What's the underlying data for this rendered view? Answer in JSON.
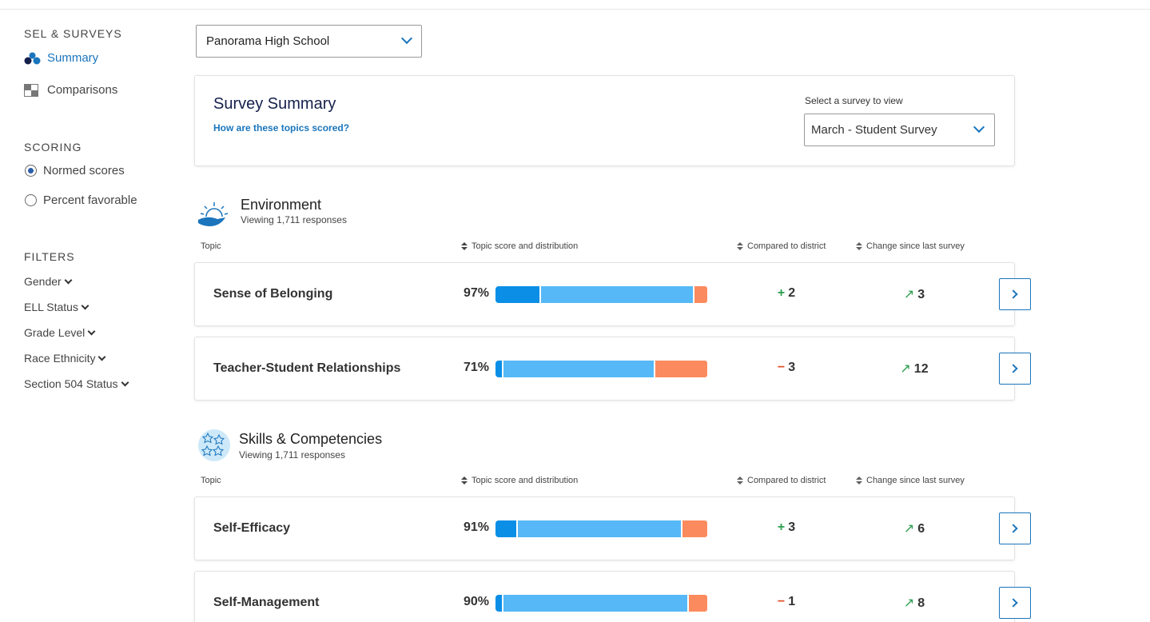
{
  "sidebar": {
    "sel_heading": "SEL & SURVEYS",
    "nav": [
      {
        "label": "Summary",
        "icon": "bubbles-icon",
        "active": true
      },
      {
        "label": "Comparisons",
        "icon": "grid-icon",
        "active": false
      }
    ],
    "scoring_heading": "SCORING",
    "scoring_options": [
      {
        "label": "Normed scores",
        "selected": true
      },
      {
        "label": "Percent favorable",
        "selected": false
      }
    ],
    "filters_heading": "FILTERS",
    "filters": [
      "Gender",
      "ELL Status",
      "Grade Level",
      "Race Ethnicity",
      "Section 504 Status"
    ]
  },
  "school_select": {
    "value": "Panorama High School"
  },
  "summary_card": {
    "title": "Survey Summary",
    "link": "How are these topics scored?",
    "survey_label": "Select a survey to view",
    "survey_value": "March - Student Survey"
  },
  "columns": {
    "topic": "Topic",
    "score": "Topic score and distribution",
    "compare": "Compared to district",
    "change": "Change since last survey"
  },
  "sections": [
    {
      "title": "Environment",
      "subtitle": "Viewing 1,711 responses",
      "icon": "sunrise-hand-icon",
      "rows": [
        {
          "name": "Sense of Belonging",
          "pct": "97%",
          "dist": [
            21,
            73,
            6
          ],
          "compare_sign": "+",
          "compare_val": "2",
          "change_val": "3"
        },
        {
          "name": "Teacher-Student Relationships",
          "pct": "71%",
          "dist": [
            3,
            72,
            25
          ],
          "compare_sign": "−",
          "compare_val": "3",
          "change_val": "12"
        }
      ]
    },
    {
      "title": "Skills & Competencies",
      "subtitle": "Viewing 1,711 responses",
      "icon": "stars-icon",
      "rows": [
        {
          "name": "Self-Efficacy",
          "pct": "91%",
          "dist": [
            10,
            78,
            12
          ],
          "compare_sign": "+",
          "compare_val": "3",
          "change_val": "6"
        },
        {
          "name": "Self-Management",
          "pct": "90%",
          "dist": [
            3,
            88,
            9
          ],
          "compare_sign": "−",
          "compare_val": "1",
          "change_val": "8"
        }
      ]
    }
  ],
  "colors": {
    "brand": "#1a75bc",
    "positive": "#2c9e4e",
    "negative": "#e0512b",
    "bar_dark": "#0a8ee6",
    "bar_light": "#56b8f6",
    "bar_orange": "#fb8b5e"
  }
}
